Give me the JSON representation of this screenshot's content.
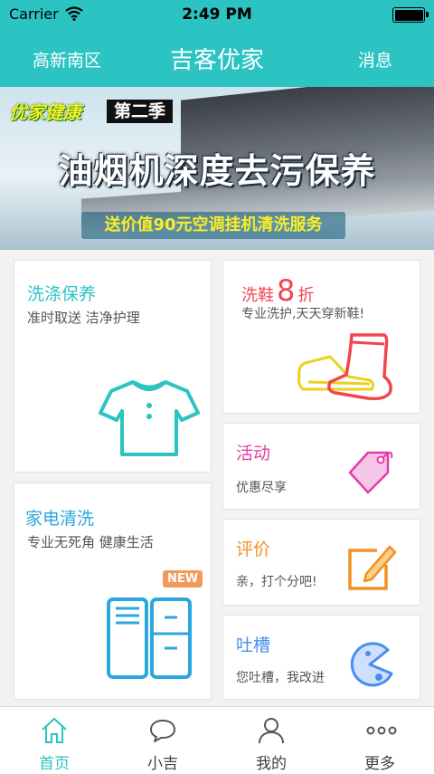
{
  "status_bar": {
    "carrier": "Carrier",
    "time": "2:49 PM"
  },
  "nav": {
    "location": "高新南区",
    "title": "吉客优家",
    "messages": "消息"
  },
  "banner": {
    "tag_left": "优家健康",
    "tag_right": "第二季",
    "headline": "油烟机深度去污保养",
    "promo": "送价值90元空调挂机清洗服务",
    "slide_count": 4,
    "active_slide_index": 1
  },
  "cards": {
    "laundry": {
      "title": "洗涤保养",
      "subtitle": "准时取送 洁净护理"
    },
    "shoes": {
      "title_pre": "洗鞋",
      "title_num": "8",
      "title_post": "折",
      "subtitle": "专业洗护,天天穿新鞋!"
    },
    "activity": {
      "title": "活动",
      "subtitle": "优惠尽享"
    },
    "appliance": {
      "title": "家电清洗",
      "subtitle": "专业无死角 健康生活",
      "badge": "NEW"
    },
    "rating": {
      "title": "评价",
      "subtitle": "亲，打个分吧!"
    },
    "feedback": {
      "title": "吐槽",
      "subtitle": "您吐槽，我改进"
    }
  },
  "colors": {
    "accent": "#2cc3c3",
    "shoes_red": "#f2464f",
    "activity_pink": "#e53aa8",
    "rating_orange": "#f39023",
    "feedback_blue": "#4a8df0",
    "appliance_blue": "#2aa7df"
  },
  "tabs": [
    {
      "label": "首页",
      "icon": "home-icon",
      "active": true
    },
    {
      "label": "小吉",
      "icon": "chat-icon",
      "active": false
    },
    {
      "label": "我的",
      "icon": "person-icon",
      "active": false
    },
    {
      "label": "更多",
      "icon": "more-icon",
      "active": false
    }
  ]
}
